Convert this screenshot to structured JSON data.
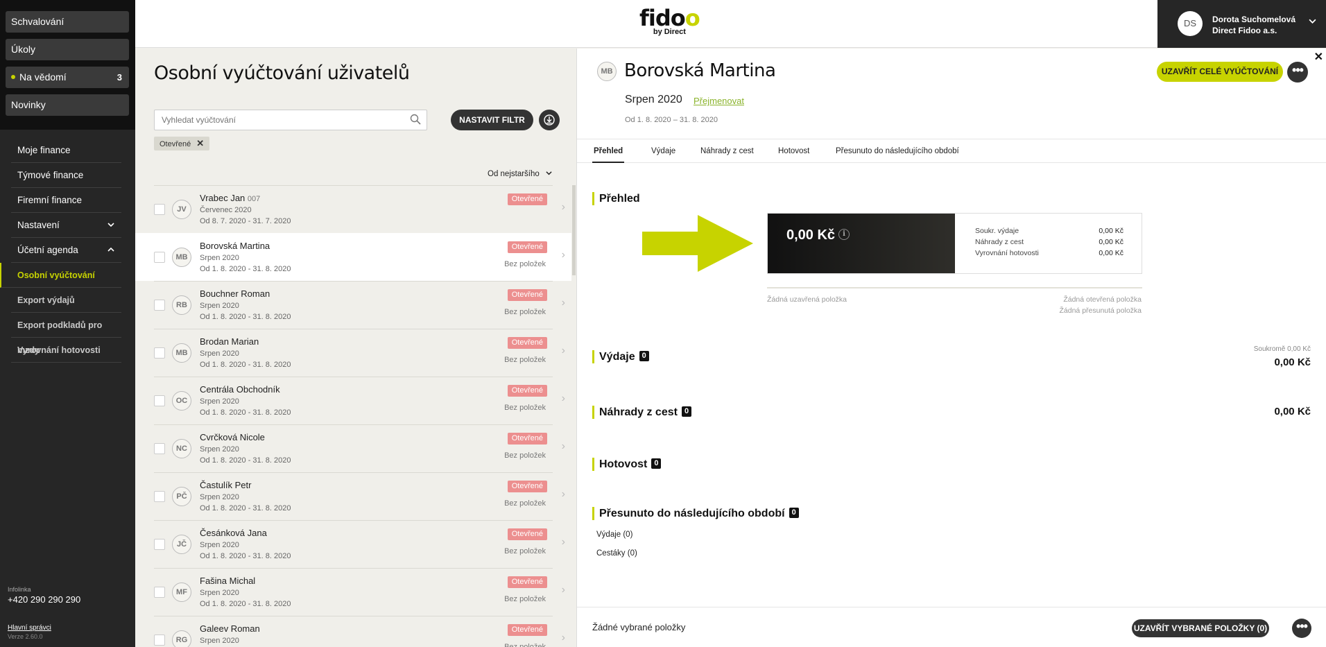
{
  "sidebar": {
    "top_buttons": [
      {
        "label": "Schvalování"
      },
      {
        "label": "Úkoly"
      },
      {
        "label": "Na vědomí",
        "count": "3"
      },
      {
        "label": "Novinky"
      }
    ],
    "nav": {
      "my_finance": "Moje finance",
      "team_finance": "Týmové finance",
      "company_finance": "Firemní finance",
      "settings": "Nastavení",
      "accounting": "Účetní agenda",
      "sub": [
        "Osobní vyúčtování",
        "Export výdajů",
        "Export podkladů pro mzdy",
        "Vyrovnání hotovosti"
      ]
    },
    "footer": {
      "infoline_label": "Infolinka",
      "phone": "+420 290 290 290",
      "admins": "Hlavní správci",
      "version": "Verze 2.60.0"
    }
  },
  "header": {
    "logo_text": "fidoo",
    "logo_sub": "by Direct",
    "user": {
      "initials": "DS",
      "name": "Dorota Suchomelová",
      "company": "Direct Fidoo a.s."
    }
  },
  "list": {
    "title": "Osobní vyúčtování uživatelů",
    "search_placeholder": "Vyhledat vyúčtování",
    "filter_button": "NASTAVIT FILTR",
    "active_chip": "Otevřené",
    "sort_label": "Od nejstaršího",
    "rows": [
      {
        "initials": "JV",
        "name": "Vrabec Jan",
        "code": "007",
        "period": "Červenec 2020",
        "dates": "Od 8. 7. 2020 - 31. 7. 2020",
        "status": "Otevřené",
        "items": ""
      },
      {
        "initials": "MB",
        "name": "Borovská Martina",
        "code": "",
        "period": "Srpen 2020",
        "dates": "Od 1. 8. 2020 - 31. 8. 2020",
        "status": "Otevřené",
        "items": "Bez položek"
      },
      {
        "initials": "RB",
        "name": "Bouchner Roman",
        "code": "",
        "period": "Srpen 2020",
        "dates": "Od 1. 8. 2020 - 31. 8. 2020",
        "status": "Otevřené",
        "items": "Bez položek"
      },
      {
        "initials": "MB",
        "name": "Brodan Marian",
        "code": "",
        "period": "Srpen 2020",
        "dates": "Od 1. 8. 2020 - 31. 8. 2020",
        "status": "Otevřené",
        "items": "Bez položek"
      },
      {
        "initials": "OC",
        "name": "Centrála Obchodník",
        "code": "",
        "period": "Srpen 2020",
        "dates": "Od 1. 8. 2020 - 31. 8. 2020",
        "status": "Otevřené",
        "items": "Bez položek"
      },
      {
        "initials": "NC",
        "name": "Cvrčková Nicole",
        "code": "",
        "period": "Srpen 2020",
        "dates": "Od 1. 8. 2020 - 31. 8. 2020",
        "status": "Otevřené",
        "items": "Bez položek"
      },
      {
        "initials": "PČ",
        "name": "Častulík Petr",
        "code": "",
        "period": "Srpen 2020",
        "dates": "Od 1. 8. 2020 - 31. 8. 2020",
        "status": "Otevřené",
        "items": "Bez položek"
      },
      {
        "initials": "JČ",
        "name": "Česánková Jana",
        "code": "",
        "period": "Srpen 2020",
        "dates": "Od 1. 8. 2020 - 31. 8. 2020",
        "status": "Otevřené",
        "items": "Bez položek"
      },
      {
        "initials": "MF",
        "name": "Fašina Michal",
        "code": "",
        "period": "Srpen 2020",
        "dates": "Od 1. 8. 2020 - 31. 8. 2020",
        "status": "Otevřené",
        "items": "Bez položek"
      },
      {
        "initials": "RG",
        "name": "Galeev Roman",
        "code": "",
        "period": "Srpen 2020",
        "dates": "",
        "status": "Otevřené",
        "items": "Bez položek"
      }
    ]
  },
  "detail": {
    "initials": "MB",
    "name": "Borovská Martina",
    "period": "Srpen 2020",
    "rename_link": "Přejmenovat",
    "dates": "Od 1. 8. 2020 – 31. 8. 2020",
    "close_all_button": "UZAVŘÍT CELÉ VYÚČTOVÁNÍ",
    "tabs": [
      "Přehled",
      "Výdaje",
      "Náhrady z cest",
      "Hotovost",
      "Přesunuto do následujícího období"
    ],
    "overview": {
      "title": "Přehled",
      "total": "0,00 Kč",
      "rows": [
        {
          "label": "Soukr. výdaje",
          "value": "0,00 Kč"
        },
        {
          "label": "Náhrady z cest",
          "value": "0,00 Kč"
        },
        {
          "label": "Vyrovnání hotovosti",
          "value": "0,00 Kč"
        }
      ],
      "no_closed": "Žádná uzavřená položka",
      "no_open": "Žádná otevřená položka",
      "no_moved": "Žádná přesunutá položka"
    },
    "expenses": {
      "title": "Výdaje",
      "count": "0",
      "private_label": "Soukromě 0,00 Kč",
      "total": "0,00 Kč"
    },
    "travel": {
      "title": "Náhrady z cest",
      "count": "0",
      "total": "0,00 Kč"
    },
    "cash": {
      "title": "Hotovost",
      "count": "0"
    },
    "moved": {
      "title": "Přesunuto do následujícího období",
      "count": "0",
      "lines": [
        "Výdaje (0)",
        "Cestáky (0)"
      ]
    },
    "footer": {
      "none_selected": "Žádné vybrané položky",
      "close_selected_button": "UZAVŘÍT VYBRANÉ POLOŽKY (0)"
    }
  },
  "colors": {
    "accent": "#c7d300",
    "status_open": "#ec8f8f",
    "sidebar_bg": "#262626"
  }
}
